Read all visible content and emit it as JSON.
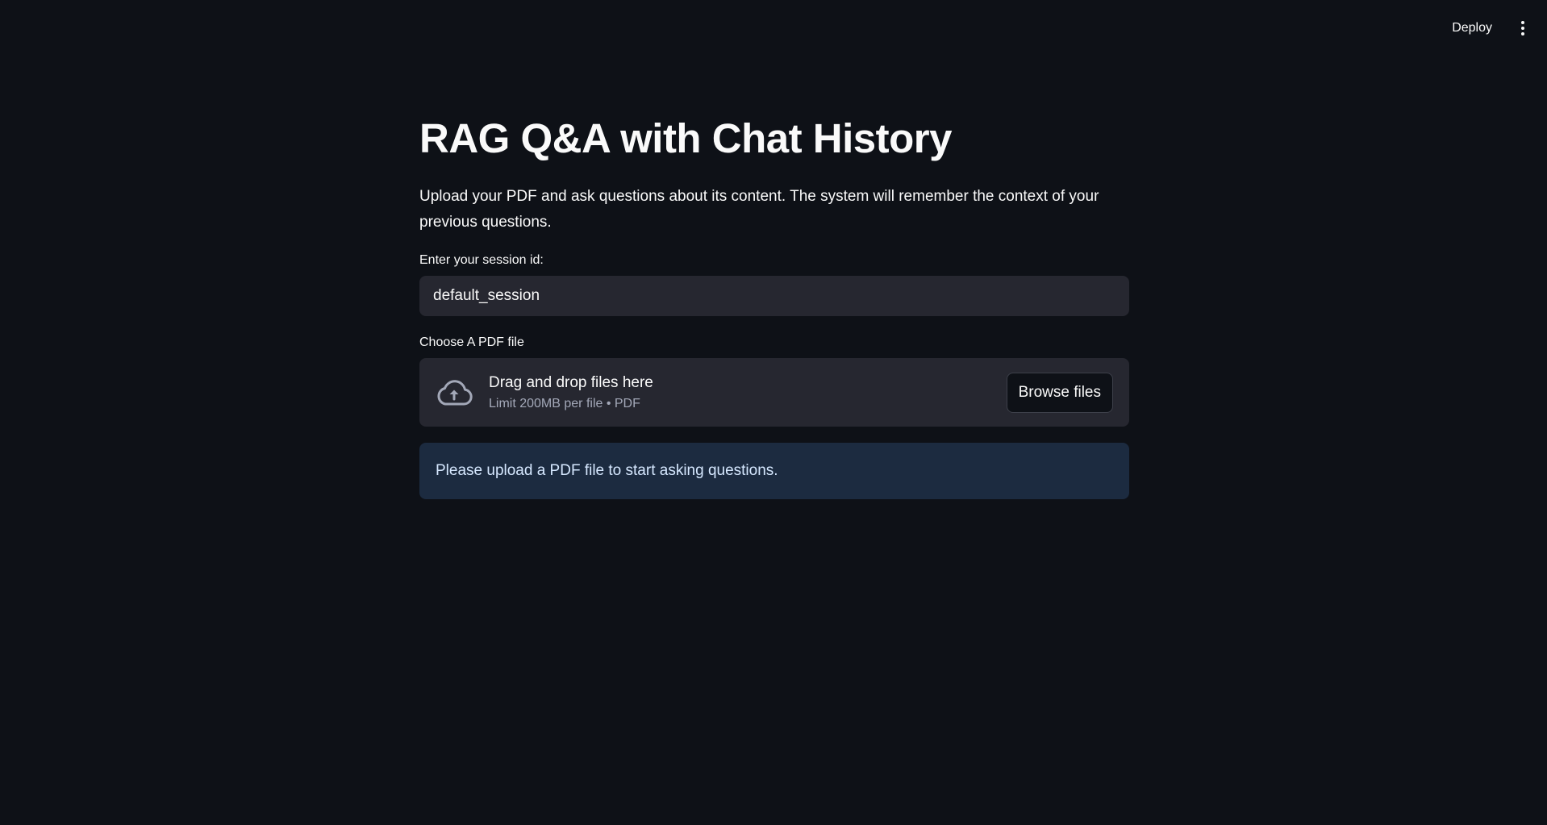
{
  "header": {
    "deploy_label": "Deploy",
    "menu_icon": "kebab-menu-icon"
  },
  "main": {
    "title": "RAG Q&A with Chat History",
    "intro": "Upload your PDF and ask questions about its content. The system will remember the context of your previous questions.",
    "session": {
      "label": "Enter your session id:",
      "value": "default_session"
    },
    "uploader": {
      "label": "Choose A PDF file",
      "icon": "cloud-upload-icon",
      "drag_text": "Drag and drop files here",
      "limit_text": "Limit 200MB per file • PDF",
      "browse_label": "Browse files"
    },
    "info_message": "Please upload a PDF file to start asking questions."
  },
  "colors": {
    "background": "#0e1117",
    "input_bg": "#262730",
    "info_bg": "#1c2b40",
    "text": "#fafafa"
  }
}
